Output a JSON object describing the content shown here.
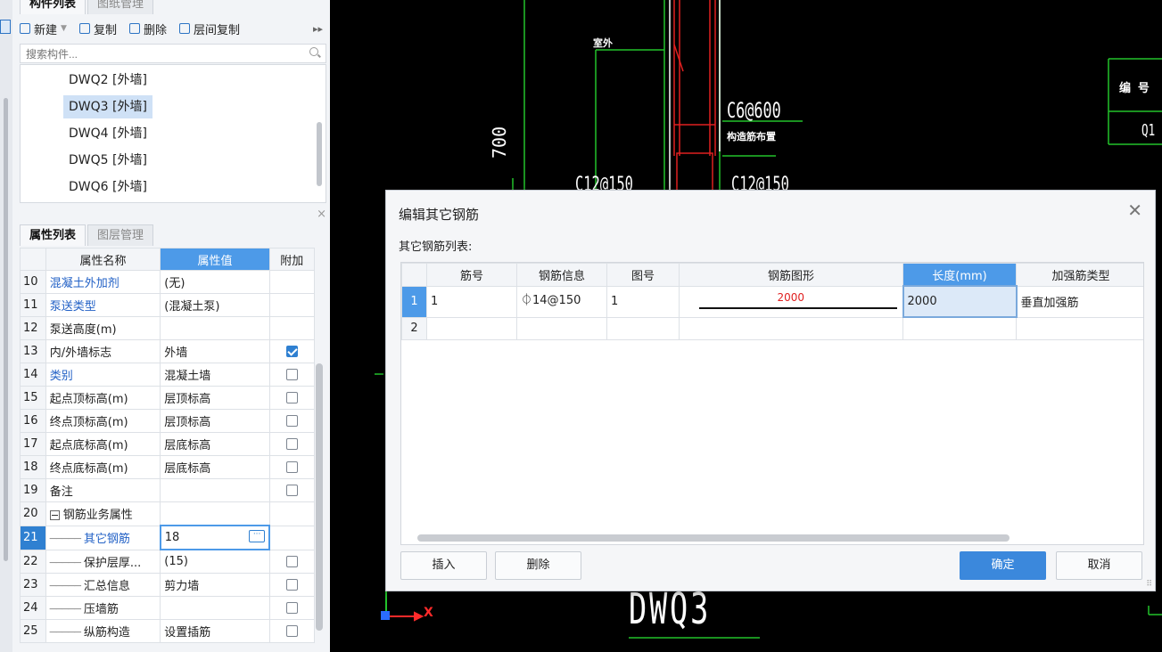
{
  "panel": {
    "tabs": [
      "构件列表",
      "图纸管理"
    ],
    "toolbar": {
      "new": "新建",
      "copy": "复制",
      "delete": "删除",
      "floor_copy": "层间复制"
    },
    "search": {
      "placeholder": "搜索构件..."
    },
    "components": [
      "DWQ2 [外墙]",
      "DWQ3 [外墙]",
      "DWQ4 [外墙]",
      "DWQ5 [外墙]",
      "DWQ6 [外墙]"
    ]
  },
  "props": {
    "tabs": [
      "属性列表",
      "图层管理"
    ],
    "headers": {
      "name": "属性名称",
      "value": "属性值",
      "extra": "附加"
    },
    "rows": [
      {
        "num": "10",
        "name": "混凝土外加剂",
        "value": "(无)"
      },
      {
        "num": "11",
        "name": "泵送类型",
        "value": "(混凝土泵)"
      },
      {
        "num": "12",
        "name": "泵送高度(m)",
        "value": ""
      },
      {
        "num": "13",
        "name": "内/外墙标志",
        "value": "外墙"
      },
      {
        "num": "14",
        "name": "类别",
        "value": "混凝土墙"
      },
      {
        "num": "15",
        "name": "起点顶标高(m)",
        "value": "层顶标高"
      },
      {
        "num": "16",
        "name": "终点顶标高(m)",
        "value": "层顶标高"
      },
      {
        "num": "17",
        "name": "起点底标高(m)",
        "value": "层底标高"
      },
      {
        "num": "18",
        "name": "终点底标高(m)",
        "value": "层底标高"
      },
      {
        "num": "19",
        "name": "备注",
        "value": ""
      },
      {
        "num": "20",
        "name": "钢筋业务属性",
        "value": ""
      },
      {
        "num": "21",
        "name": "其它钢筋",
        "value": "18"
      },
      {
        "num": "22",
        "name": "保护层厚...",
        "value": "(15)"
      },
      {
        "num": "23",
        "name": "汇总信息",
        "value": "剪力墙"
      },
      {
        "num": "24",
        "name": "压墙筋",
        "value": ""
      },
      {
        "num": "25",
        "name": "纵筋构造",
        "value": "设置插筋"
      }
    ]
  },
  "cad": {
    "label_stirrup": "C6@600",
    "label_dist": "构造筋布置",
    "label_c12a": "C12@150",
    "label_c12b": "C12@150",
    "dim_700": "700",
    "wall_name": "DWQ3",
    "small_label": "室外",
    "table_header": "编 号",
    "table_q1": "Q1",
    "axis_x": "X"
  },
  "dialog": {
    "title": "编辑其它钢筋",
    "subtitle": "其它钢筋列表:",
    "columns": [
      "筋号",
      "钢筋信息",
      "图号",
      "钢筋图形",
      "长度(mm)",
      "加强筋类型"
    ],
    "rows": [
      {
        "rn": "1",
        "bar_no": "1",
        "bar_info": "⏀14@150",
        "fig_no": "1",
        "shape_len": "2000",
        "length": "2000",
        "type": "垂直加强筋"
      },
      {
        "rn": "2",
        "bar_no": "",
        "bar_info": "",
        "fig_no": "",
        "shape_len": "",
        "length": "",
        "type": ""
      }
    ],
    "buttons": {
      "insert": "插入",
      "delete": "删除",
      "ok": "确定",
      "cancel": "取消"
    }
  },
  "colors": {
    "accent": "#3b88dc",
    "header_highlight": "#4d9ae8",
    "cad_green": "#22c32b",
    "cad_red": "#e02020"
  }
}
